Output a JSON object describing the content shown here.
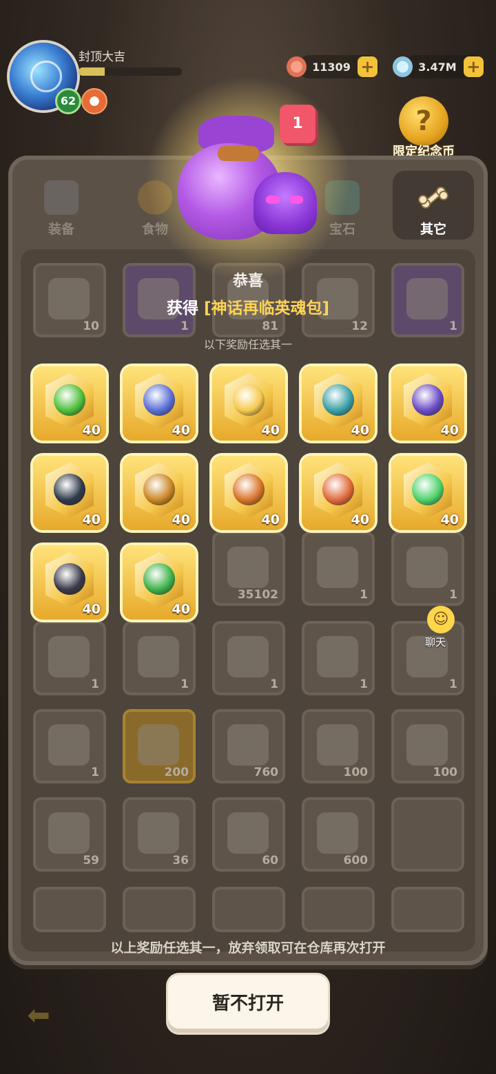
{
  "player": {
    "name": "封顶大吉",
    "level": "62",
    "exp_fraction": 0.25
  },
  "currencies": [
    {
      "icon": "starfish-icon",
      "value": "11309"
    },
    {
      "icon": "shell-icon",
      "value": "3.47M"
    }
  ],
  "limited_coin": {
    "icon": "question-coin-icon",
    "label": "限定纪念币"
  },
  "tabs": [
    {
      "label": "装备",
      "icon": "equipment-icon"
    },
    {
      "label": "食物",
      "icon": "food-icon"
    },
    {
      "label": "",
      "icon": ""
    },
    {
      "label": "宝石",
      "icon": "gem-icon"
    },
    {
      "label": "其它",
      "icon": "bone-icon",
      "active": true
    }
  ],
  "inventory": [
    {
      "count": "10"
    },
    {
      "count": "1"
    },
    {
      "count": "81"
    },
    {
      "count": "12"
    },
    {
      "count": "1"
    },
    {
      "count": "35102"
    },
    {
      "count": "1"
    },
    {
      "count": "1"
    },
    {
      "count": "1"
    },
    {
      "count": "1"
    },
    {
      "count": "1"
    },
    {
      "count": "1"
    },
    {
      "count": "1"
    },
    {
      "count": "1"
    },
    {
      "count": "200"
    },
    {
      "count": "760"
    },
    {
      "count": "100"
    },
    {
      "count": "100"
    },
    {
      "count": "59"
    },
    {
      "count": "36"
    },
    {
      "count": "60"
    },
    {
      "count": "600"
    }
  ],
  "modal": {
    "badge_count": "1",
    "title": "恭喜",
    "obtained_prefix": "获得 ",
    "obtained_item": "[神话再临英魂包]",
    "subtitle": "以下奖励任选其一",
    "rewards": [
      {
        "count": "40",
        "color": "#4fbf3a"
      },
      {
        "count": "40",
        "color": "#5a6fd6"
      },
      {
        "count": "40",
        "color": "#f6c94e"
      },
      {
        "count": "40",
        "color": "#3aa0a8"
      },
      {
        "count": "40",
        "color": "#6a4cc6"
      },
      {
        "count": "40",
        "color": "#2f3a4a"
      },
      {
        "count": "40",
        "color": "#c98624"
      },
      {
        "count": "40",
        "color": "#d8742a"
      },
      {
        "count": "40",
        "color": "#e06a3a"
      },
      {
        "count": "40",
        "color": "#4ed36a"
      },
      {
        "count": "40",
        "color": "#3a3a4a"
      },
      {
        "count": "40",
        "color": "#3fb24a"
      }
    ],
    "footer_note": "以上奖励任选其一，放弃领取可在仓库再次打开",
    "close_button": "暂不打开"
  },
  "chat": {
    "label": "聊天"
  }
}
